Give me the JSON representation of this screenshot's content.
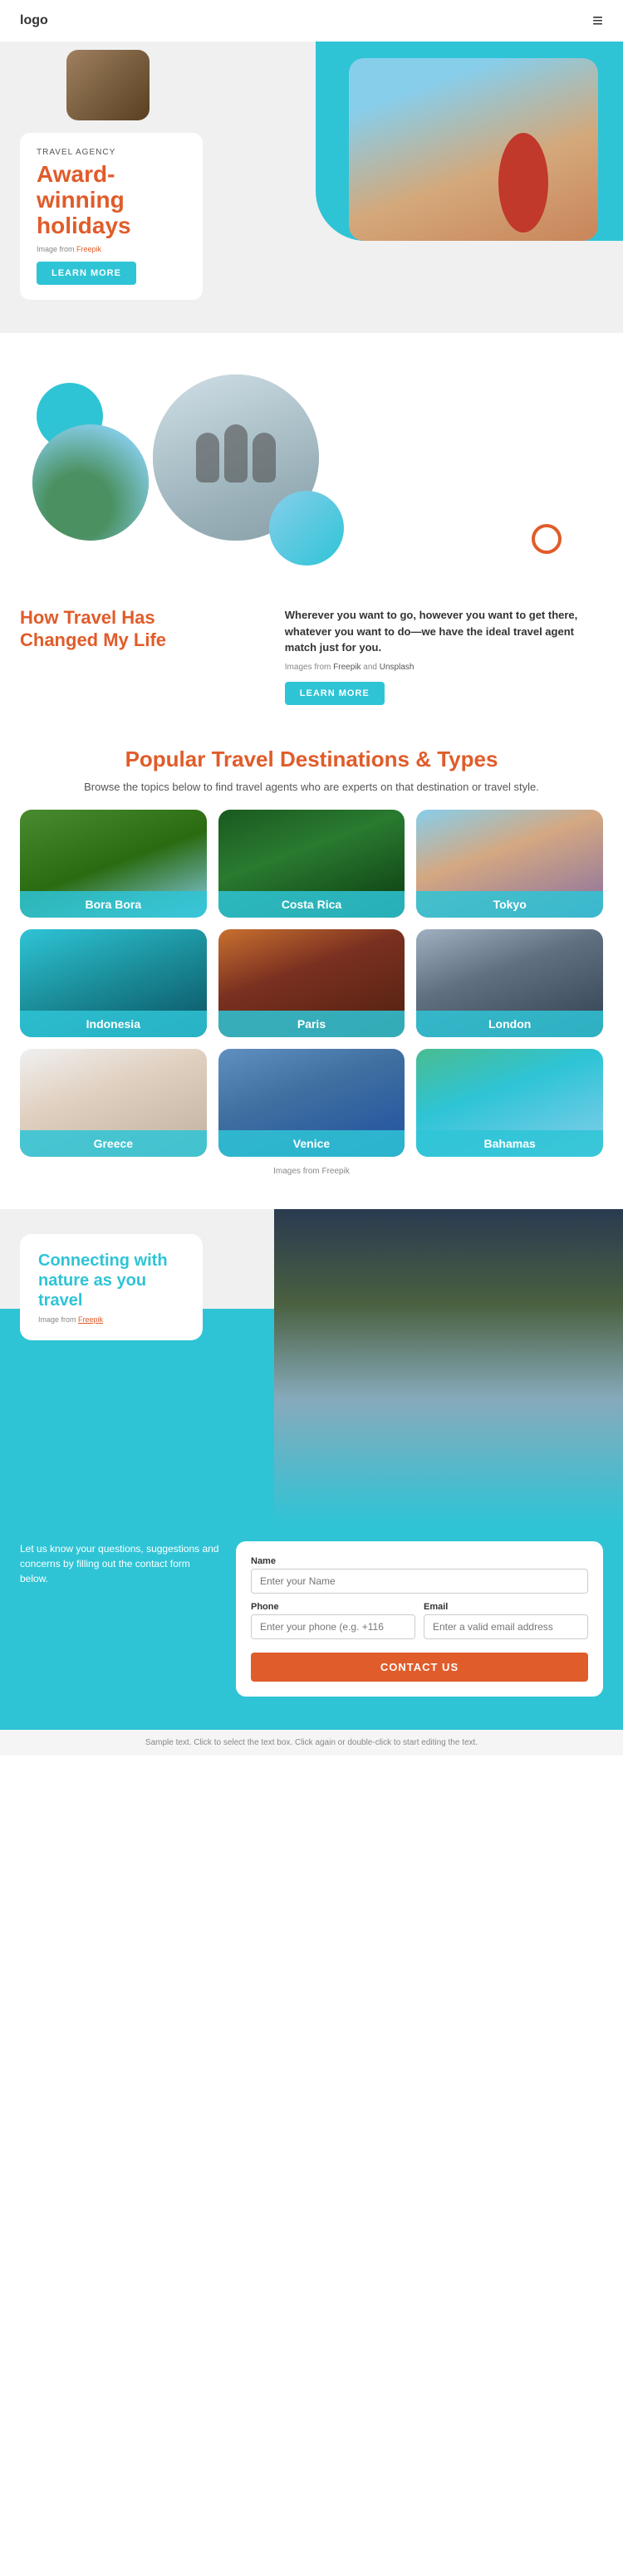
{
  "header": {
    "logo": "logo",
    "menu_icon": "≡"
  },
  "hero": {
    "agency_label": "TRAVEL AGENCY",
    "title": "Award-winning holidays",
    "image_credit_text": "Image from",
    "image_credit_link": "Freepik",
    "learn_more": "LEARN MORE"
  },
  "travel": {
    "heading_line1": "How Travel Has",
    "heading_line2": "Changed My Life",
    "description": "Wherever you want to go, however you want to get there, whatever you want to do—we have the ideal travel agent match just for you.",
    "credits_text": "Images from",
    "credit_link1": "Freepik",
    "credit_and": "and",
    "credit_link2": "Unsplash",
    "learn_more": "LEARN MORE"
  },
  "destinations": {
    "heading": "Popular Travel Destinations & Types",
    "description": "Browse the topics below to find travel agents who are experts on that destination or travel style.",
    "cards": [
      {
        "label": "Bora Bora",
        "bg_class": "bg-bora-bora"
      },
      {
        "label": "Costa Rica",
        "bg_class": "bg-costa-rica"
      },
      {
        "label": "Tokyo",
        "bg_class": "bg-tokyo"
      },
      {
        "label": "Indonesia",
        "bg_class": "bg-indonesia"
      },
      {
        "label": "Paris",
        "bg_class": "bg-paris"
      },
      {
        "label": "London",
        "bg_class": "bg-london"
      },
      {
        "label": "Greece",
        "bg_class": "bg-greece"
      },
      {
        "label": "Venice",
        "bg_class": "bg-venice"
      },
      {
        "label": "Bahamas",
        "bg_class": "bg-bahamas"
      }
    ],
    "credits_text": "Images from Freepik"
  },
  "nature": {
    "heading": "Connecting with nature as you travel",
    "credit_text": "Image from",
    "credit_link": "Freepik"
  },
  "contact": {
    "description": "Let us know your questions, suggestions and concerns by filling out the contact form below.",
    "form": {
      "name_label": "Name",
      "name_placeholder": "Enter your Name",
      "phone_label": "Phone",
      "phone_placeholder": "Enter your phone (e.g. +116",
      "email_label": "Email",
      "email_placeholder": "Enter a valid email address",
      "submit_label": "CONTACT US"
    }
  },
  "footer": {
    "note": "Sample text. Click to select the text box. Click again or double-click to start editing the text."
  }
}
